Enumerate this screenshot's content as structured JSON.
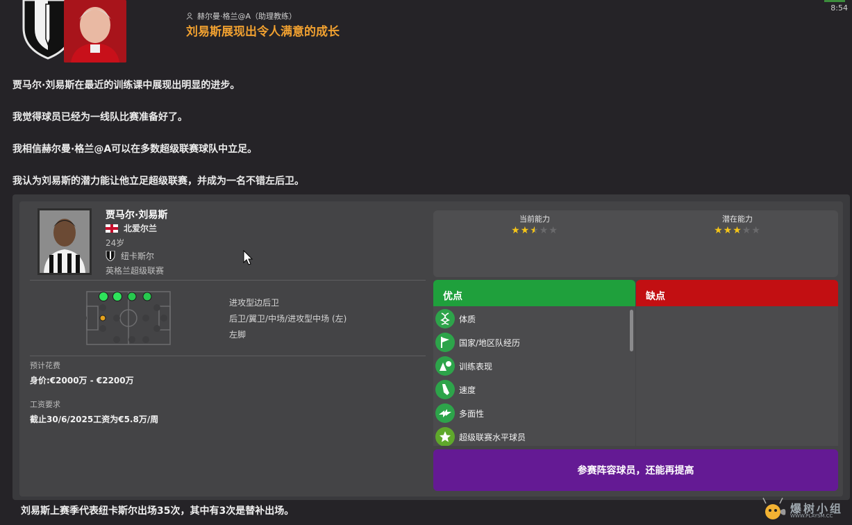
{
  "header": {
    "sender": "赫尔曼·格兰@A（助理教练）",
    "headline": "刘易斯展现出令人满意的成长",
    "clock": "8:54"
  },
  "message": {
    "lines": [
      "贾马尔·刘易斯在最近的训练课中展现出明显的进步。",
      "我觉得球员已经为一线队比赛准备好了。",
      "我相信赫尔曼·格兰@A可以在多数超级联赛球队中立足。",
      "我认为刘易斯的潜力能让他立足超级联赛，并成为一名不错左后卫。"
    ]
  },
  "player": {
    "name": "贾马尔·刘易斯",
    "nation": "北爱尔兰",
    "age": "24岁",
    "club": "纽卡斯尔",
    "league": "英格兰超级联赛",
    "role": "进攻型边后卫",
    "positions": "后卫/翼卫/中场/进攻型中场 (左)",
    "foot": "左脚"
  },
  "finance": {
    "fee_label": "预计花费",
    "fee_value": "身价:€2000万 - €2200万",
    "wage_label": "工资要求",
    "wage_value": "截止30/6/2025工资为€5.8万/周"
  },
  "ability": {
    "current_label": "当前能力",
    "current_stars": 2.5,
    "potential_label": "潜在能力",
    "potential_stars": 3,
    "star_color": "#f5c518"
  },
  "pros": {
    "title": "优点",
    "color": "#1fa03c",
    "items": [
      {
        "label": "体质",
        "icon": "dna-icon"
      },
      {
        "label": "国家/地区队经历",
        "icon": "flag-icon"
      },
      {
        "label": "训练表现",
        "icon": "training-cones-icon"
      },
      {
        "label": "速度",
        "icon": "boot-icon"
      },
      {
        "label": "多面性",
        "icon": "arrows-icon"
      },
      {
        "label": "超级联赛水平球员",
        "icon": "star-icon"
      }
    ]
  },
  "cons": {
    "title": "缺点",
    "color": "#c20f12"
  },
  "verdict": "参赛阵容球员，还能再提高",
  "footer": "刘易斯上赛季代表纽卡斯尔出场35次，其中有3次是替补出场。",
  "watermark": {
    "title": "爆树小组",
    "sub": "WWW.PLAYSM.CC"
  }
}
